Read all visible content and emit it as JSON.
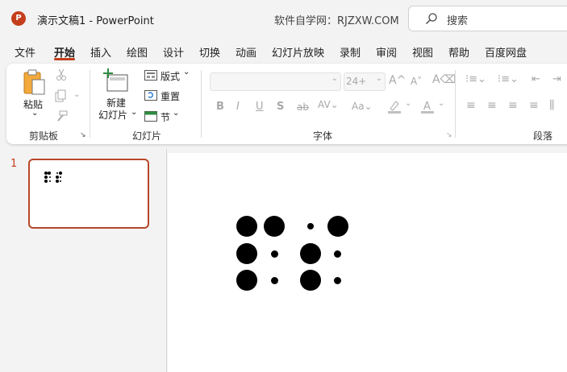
{
  "app": {
    "logo_letter": "P",
    "title": "演示文稿1  -  PowerPoint",
    "watermark": "软件自学网：RJZXW.COM"
  },
  "search": {
    "placeholder": "搜索"
  },
  "tabs": [
    "文件",
    "开始",
    "插入",
    "绘图",
    "设计",
    "切换",
    "动画",
    "幻灯片放映",
    "录制",
    "审阅",
    "视图",
    "帮助",
    "百度网盘"
  ],
  "active_tab": "开始",
  "ribbon": {
    "clipboard": {
      "paste": "粘贴",
      "group": "剪贴板"
    },
    "slides": {
      "new_slide_line1": "新建",
      "new_slide_line2": "幻灯片",
      "layout": "版式",
      "reset": "重置",
      "section": "节",
      "group": "幻灯片"
    },
    "font": {
      "size_value": "24+",
      "group": "字体"
    },
    "paragraph": {
      "group": "段落"
    }
  },
  "thumbnails": {
    "slide_number": "1"
  },
  "colors": {
    "accent": "#c43e1c",
    "thumb_border": "#b7472a"
  }
}
